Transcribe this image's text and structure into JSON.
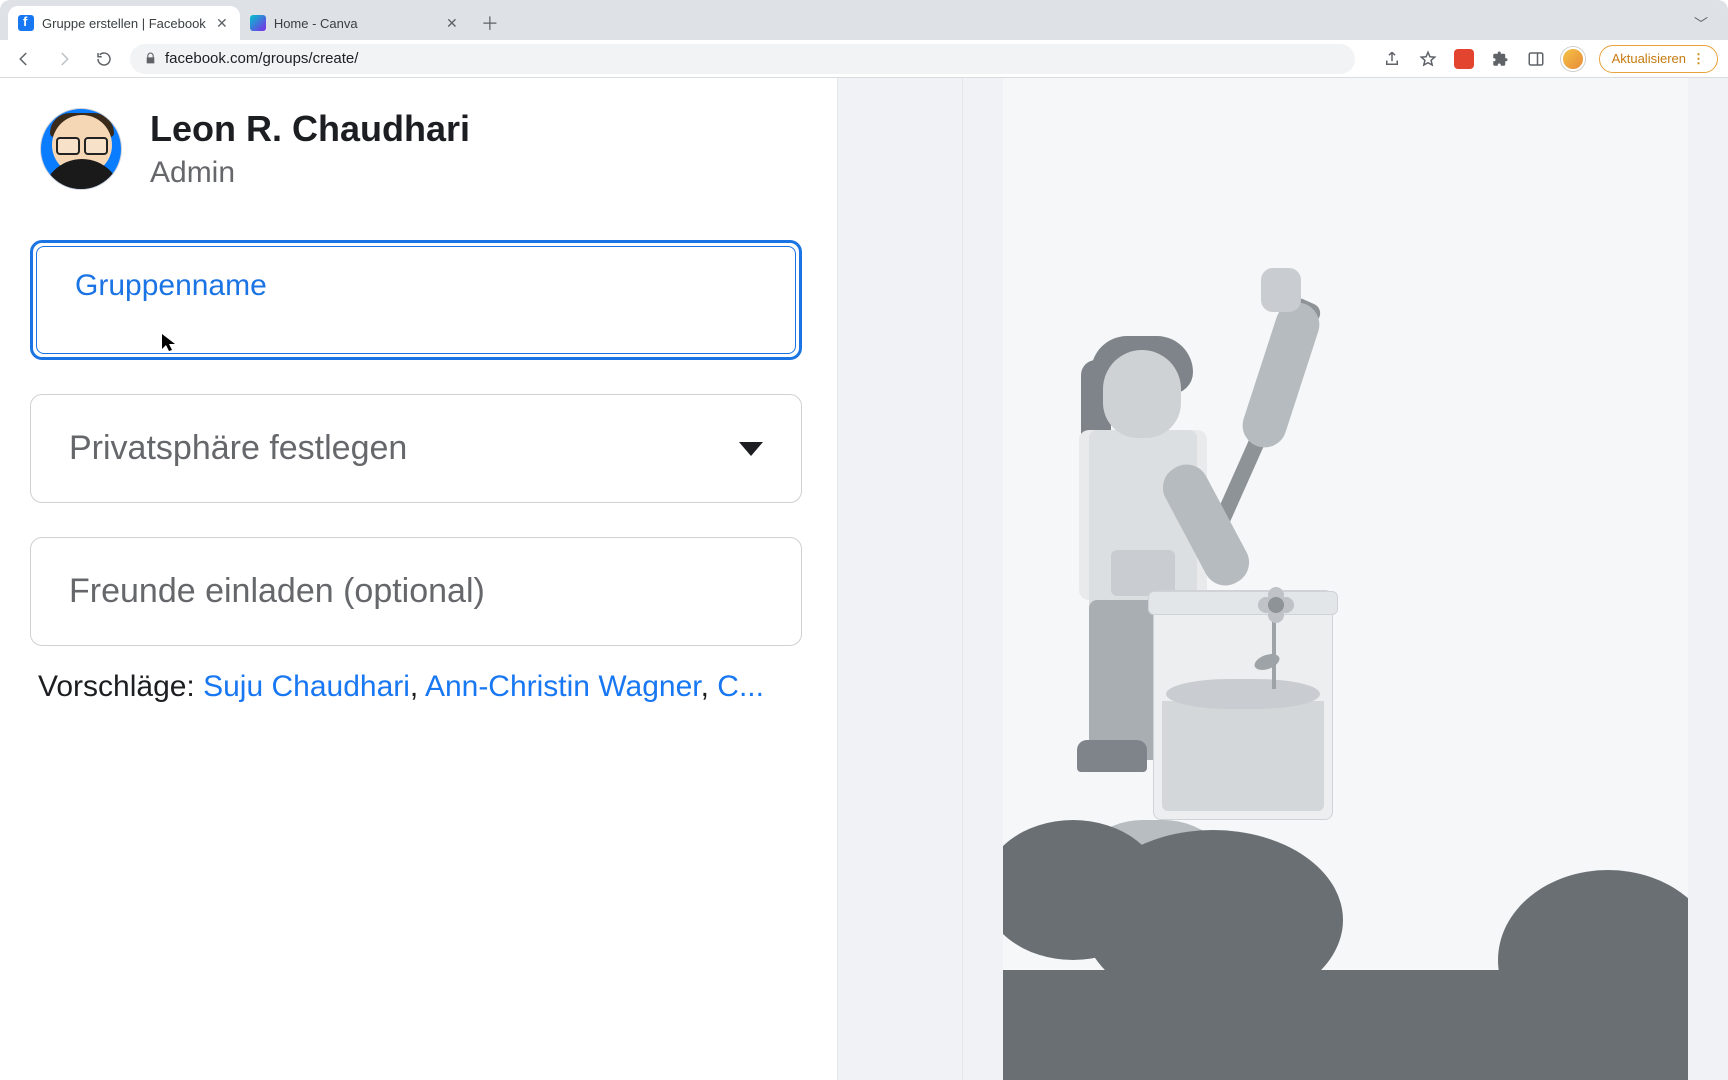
{
  "browser": {
    "tabs": [
      {
        "title": "Gruppe erstellen | Facebook",
        "favicon": "facebook"
      },
      {
        "title": "Home - Canva",
        "favicon": "canva"
      }
    ],
    "url": "facebook.com/groups/create/",
    "update_label": "Aktualisieren"
  },
  "user": {
    "name": "Leon R. Chaudhari",
    "role": "Admin"
  },
  "form": {
    "group_name_label": "Gruppenname",
    "privacy_label": "Privatsphäre festlegen",
    "invite_label": "Freunde einladen (optional)"
  },
  "suggestions": {
    "label": "Vorschläge: ",
    "people": [
      "Suju Chaudhari",
      "Ann-Christin Wagner",
      "C..."
    ]
  }
}
